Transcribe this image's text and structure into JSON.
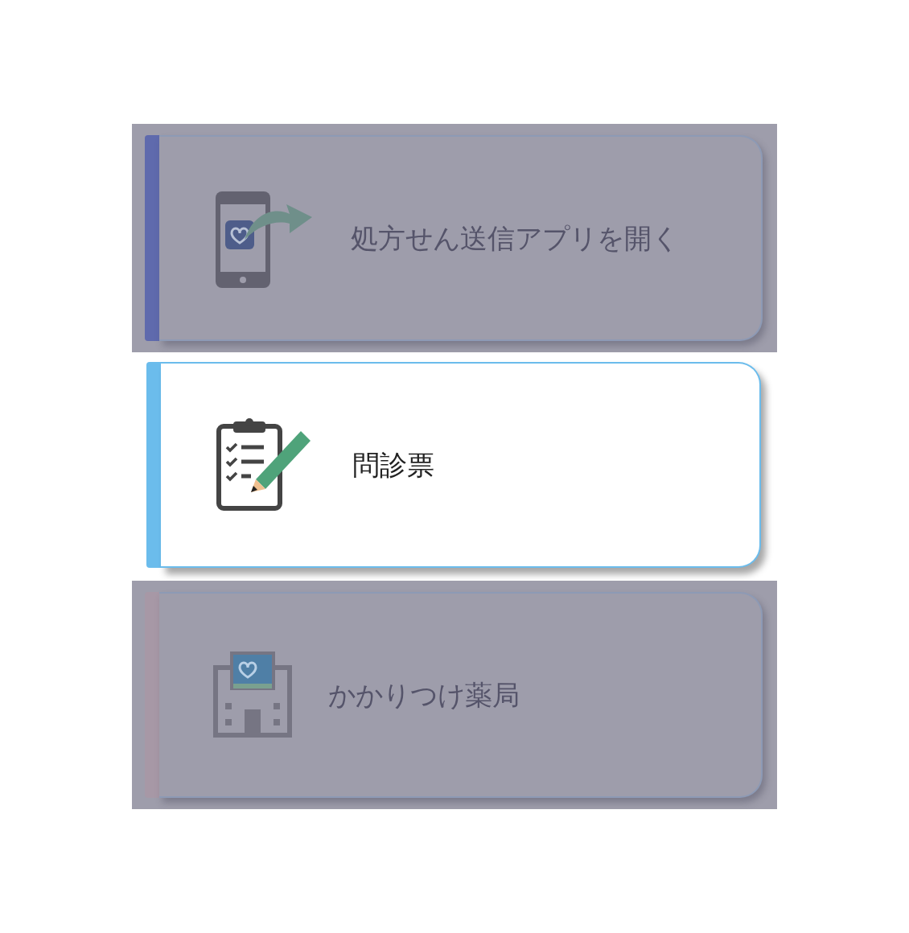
{
  "menu_items": [
    {
      "kind": "phone",
      "label": "処方せん送信アプリを開く",
      "selected": false,
      "color": "#5f6aad"
    },
    {
      "kind": "clipboard",
      "label": "問診票",
      "selected": true,
      "color": "#6bbcec"
    },
    {
      "kind": "pharmacy",
      "label": "かかりつけ薬局",
      "selected": false,
      "color": "#a798a6"
    }
  ]
}
